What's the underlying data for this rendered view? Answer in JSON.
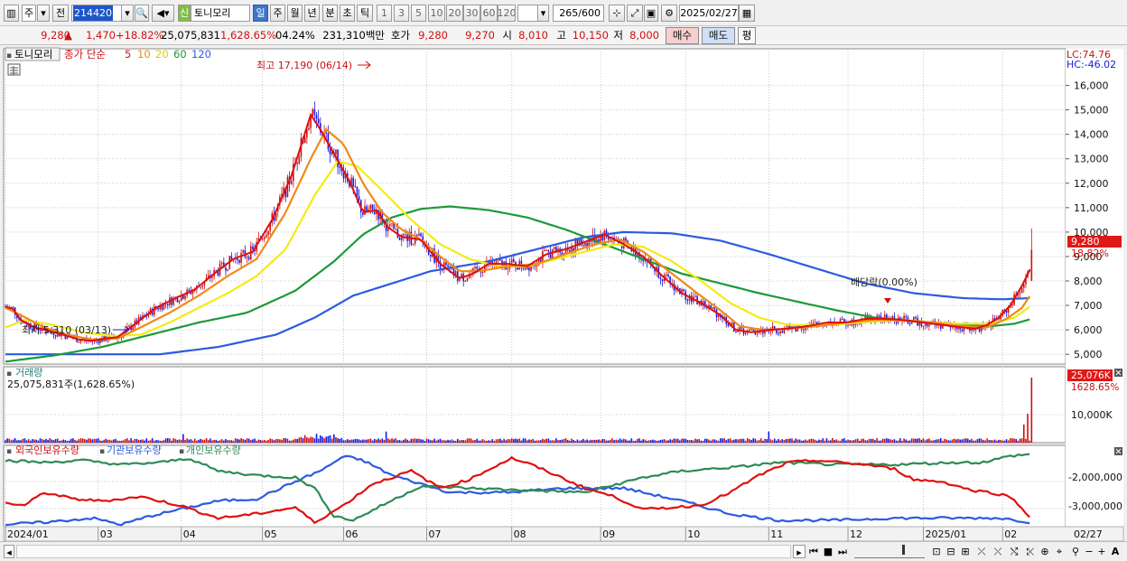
{
  "toolbar": {
    "market": "주",
    "period_prefix": "전",
    "stock_code": "214420",
    "credit_badge": "신",
    "stock_name": "토니모리",
    "period_tabs": [
      "일",
      "주",
      "월",
      "년",
      "분",
      "초",
      "틱"
    ],
    "interval_buttons": [
      "1",
      "3",
      "5",
      "10",
      "20",
      "30",
      "60",
      "120"
    ],
    "count": "265",
    "count_max": "/600",
    "date": "2025/02/27"
  },
  "quote": {
    "price": "9,280",
    "change_arrow": "▲",
    "change": "1,470",
    "change_pct": "+18.82%",
    "volume": "25,075,831",
    "volume_pct": "1,628.65%",
    "turnover": "04.24%",
    "amount": "231,310백만",
    "bid_label": "호가",
    "ask_price": "9,280",
    "bid_price": "9,270",
    "open_label": "시",
    "open": "8,010",
    "high_label": "고",
    "high": "10,150",
    "low_label": "저",
    "low": "8,000",
    "buy_label": "매수",
    "sell_label": "매도",
    "eval_label": "평"
  },
  "price_panel": {
    "stock_name": "토니모리",
    "ma_label": "종가 단순",
    "ma_periods": [
      "5",
      "10",
      "20",
      "60",
      "120"
    ],
    "lc": "LC:74.76",
    "hc": "HC:-46.02",
    "high_annotation": "최고 17,190 (06/14)",
    "low_annotation": "최저 5,310 (03/13)",
    "dividend_annotation": "배당락(0.00%)",
    "current_price_tag": "9,280",
    "current_pct_tag": "18.82%",
    "y_ticks": [
      "16,000",
      "15,000",
      "14,000",
      "13,000",
      "12,000",
      "11,000",
      "10,000",
      "9,000",
      "8,000",
      "7,000",
      "6,000",
      "5,000"
    ]
  },
  "volume_panel": {
    "title": "거래량",
    "info": "25,075,831주(1,628.65%)",
    "tag_value": "25,076K",
    "tag_pct": "1628.65%",
    "y_tick": "10,000K"
  },
  "holdings_panel": {
    "legends": [
      "외국인보유수량",
      "기관보유수량",
      "개인보유수량"
    ],
    "y_ticks": [
      "-2,000,000",
      "-3,000,000"
    ]
  },
  "x_axis": {
    "labels": [
      "2024/01",
      "03",
      "04",
      "05",
      "06",
      "07",
      "08",
      "09",
      "10",
      "11",
      "12",
      "2025/01",
      "02"
    ],
    "last_date": "02/27"
  },
  "colors": {
    "up": "#d01010",
    "down": "#1a1adf",
    "ma5": "#dd1010",
    "ma10": "#f08a18",
    "ma20": "#f2ec12",
    "ma60": "#1b9a3a",
    "ma120": "#2d5be0",
    "foreign": "#e01010",
    "institution": "#2d5be0",
    "individual": "#2e8b57"
  },
  "chart_data": {
    "type": "line",
    "x_range": [
      "2024/01",
      "02/27"
    ],
    "series": [
      {
        "name": "5",
        "points": [
          [
            0,
            6950
          ],
          [
            4,
            6850
          ],
          [
            8,
            6400
          ],
          [
            15,
            6100
          ],
          [
            23,
            5950
          ],
          [
            30,
            5800
          ],
          [
            38,
            5600
          ],
          [
            45,
            5550
          ],
          [
            52,
            5650
          ],
          [
            58,
            5700
          ],
          [
            68,
            6300
          ],
          [
            78,
            6900
          ],
          [
            88,
            7300
          ],
          [
            98,
            7650
          ],
          [
            108,
            8300
          ],
          [
            118,
            8900
          ],
          [
            128,
            9200
          ],
          [
            138,
            10500
          ],
          [
            148,
            12300
          ],
          [
            158,
            14800
          ],
          [
            163,
            14200
          ],
          [
            170,
            13200
          ],
          [
            178,
            12100
          ],
          [
            185,
            10800
          ],
          [
            192,
            10900
          ],
          [
            198,
            10200
          ],
          [
            205,
            9800
          ],
          [
            215,
            9700
          ],
          [
            225,
            8700
          ],
          [
            235,
            8100
          ],
          [
            242,
            8300
          ],
          [
            250,
            8700
          ],
          [
            260,
            8700
          ],
          [
            270,
            8600
          ],
          [
            280,
            9100
          ],
          [
            290,
            9300
          ],
          [
            300,
            9600
          ],
          [
            310,
            9900
          ],
          [
            320,
            9500
          ],
          [
            330,
            9000
          ],
          [
            340,
            8200
          ],
          [
            350,
            7500
          ],
          [
            360,
            7100
          ],
          [
            370,
            6600
          ],
          [
            378,
            6000
          ],
          [
            386,
            5900
          ],
          [
            395,
            6000
          ],
          [
            405,
            6050
          ],
          [
            415,
            6150
          ],
          [
            425,
            6300
          ],
          [
            435,
            6300
          ],
          [
            445,
            6450
          ],
          [
            455,
            6450
          ],
          [
            465,
            6400
          ],
          [
            475,
            6300
          ],
          [
            485,
            6200
          ],
          [
            495,
            6100
          ],
          [
            502,
            6050
          ],
          [
            508,
            6200
          ],
          [
            514,
            6500
          ],
          [
            520,
            7000
          ],
          [
            526,
            7800
          ],
          [
            531,
            8600
          ]
        ]
      },
      {
        "name": "10",
        "points": [
          [
            0,
            6900
          ],
          [
            8,
            6600
          ],
          [
            20,
            6100
          ],
          [
            32,
            5800
          ],
          [
            45,
            5600
          ],
          [
            58,
            5650
          ],
          [
            70,
            6100
          ],
          [
            85,
            6700
          ],
          [
            100,
            7400
          ],
          [
            115,
            8200
          ],
          [
            130,
            8900
          ],
          [
            145,
            10800
          ],
          [
            158,
            13000
          ],
          [
            166,
            14200
          ],
          [
            175,
            13600
          ],
          [
            185,
            12000
          ],
          [
            195,
            10800
          ],
          [
            205,
            10100
          ],
          [
            215,
            9700
          ],
          [
            225,
            9000
          ],
          [
            235,
            8400
          ],
          [
            245,
            8400
          ],
          [
            260,
            8600
          ],
          [
            275,
            8700
          ],
          [
            290,
            9100
          ],
          [
            305,
            9500
          ],
          [
            318,
            9700
          ],
          [
            330,
            9200
          ],
          [
            345,
            8300
          ],
          [
            358,
            7500
          ],
          [
            370,
            6800
          ],
          [
            380,
            6150
          ],
          [
            392,
            6000
          ],
          [
            405,
            6050
          ],
          [
            420,
            6150
          ],
          [
            435,
            6300
          ],
          [
            450,
            6400
          ],
          [
            465,
            6400
          ],
          [
            480,
            6300
          ],
          [
            495,
            6150
          ],
          [
            508,
            6100
          ],
          [
            518,
            6450
          ],
          [
            526,
            6900
          ],
          [
            531,
            7500
          ]
        ]
      },
      {
        "name": "20",
        "points": [
          [
            0,
            6100
          ],
          [
            10,
            6400
          ],
          [
            25,
            6200
          ],
          [
            40,
            5900
          ],
          [
            55,
            5750
          ],
          [
            70,
            5800
          ],
          [
            85,
            6300
          ],
          [
            100,
            6900
          ],
          [
            115,
            7500
          ],
          [
            130,
            8200
          ],
          [
            145,
            9300
          ],
          [
            160,
            11500
          ],
          [
            172,
            12900
          ],
          [
            182,
            12700
          ],
          [
            195,
            11700
          ],
          [
            210,
            10500
          ],
          [
            225,
            9500
          ],
          [
            240,
            8900
          ],
          [
            255,
            8600
          ],
          [
            270,
            8600
          ],
          [
            285,
            8900
          ],
          [
            300,
            9200
          ],
          [
            315,
            9500
          ],
          [
            330,
            9400
          ],
          [
            345,
            8800
          ],
          [
            360,
            8000
          ],
          [
            375,
            7100
          ],
          [
            390,
            6500
          ],
          [
            405,
            6200
          ],
          [
            420,
            6200
          ],
          [
            435,
            6250
          ],
          [
            450,
            6350
          ],
          [
            465,
            6400
          ],
          [
            480,
            6300
          ],
          [
            495,
            6250
          ],
          [
            510,
            6250
          ],
          [
            522,
            6500
          ],
          [
            531,
            7000
          ]
        ]
      },
      {
        "name": "60",
        "points": [
          [
            0,
            4700
          ],
          [
            25,
            4950
          ],
          [
            50,
            5300
          ],
          [
            75,
            5800
          ],
          [
            100,
            6300
          ],
          [
            125,
            6700
          ],
          [
            150,
            7600
          ],
          [
            170,
            8800
          ],
          [
            185,
            9900
          ],
          [
            200,
            10600
          ],
          [
            215,
            10950
          ],
          [
            230,
            11050
          ],
          [
            250,
            10900
          ],
          [
            270,
            10600
          ],
          [
            290,
            10100
          ],
          [
            310,
            9500
          ],
          [
            330,
            8900
          ],
          [
            350,
            8300
          ],
          [
            370,
            7900
          ],
          [
            390,
            7500
          ],
          [
            410,
            7150
          ],
          [
            430,
            6800
          ],
          [
            450,
            6500
          ],
          [
            470,
            6350
          ],
          [
            490,
            6200
          ],
          [
            510,
            6150
          ],
          [
            522,
            6250
          ],
          [
            531,
            6450
          ]
        ]
      },
      {
        "name": "120",
        "points": [
          [
            0,
            5000
          ],
          [
            40,
            5000
          ],
          [
            80,
            5000
          ],
          [
            110,
            5300
          ],
          [
            140,
            5800
          ],
          [
            160,
            6500
          ],
          [
            180,
            7400
          ],
          [
            200,
            7900
          ],
          [
            220,
            8400
          ],
          [
            250,
            8800
          ],
          [
            280,
            9400
          ],
          [
            300,
            9800
          ],
          [
            320,
            10000
          ],
          [
            345,
            9950
          ],
          [
            370,
            9650
          ],
          [
            395,
            9100
          ],
          [
            420,
            8500
          ],
          [
            445,
            7900
          ],
          [
            470,
            7500
          ],
          [
            495,
            7300
          ],
          [
            515,
            7250
          ],
          [
            531,
            7300
          ]
        ]
      }
    ],
    "high": {
      "value": 17190,
      "date": "06/14"
    },
    "low": {
      "value": 5310,
      "date": "03/13"
    },
    "last_close": 9280,
    "ylim": [
      4600,
      17500
    ],
    "holdings_ylim": [
      -3400000,
      -1500000
    ]
  }
}
